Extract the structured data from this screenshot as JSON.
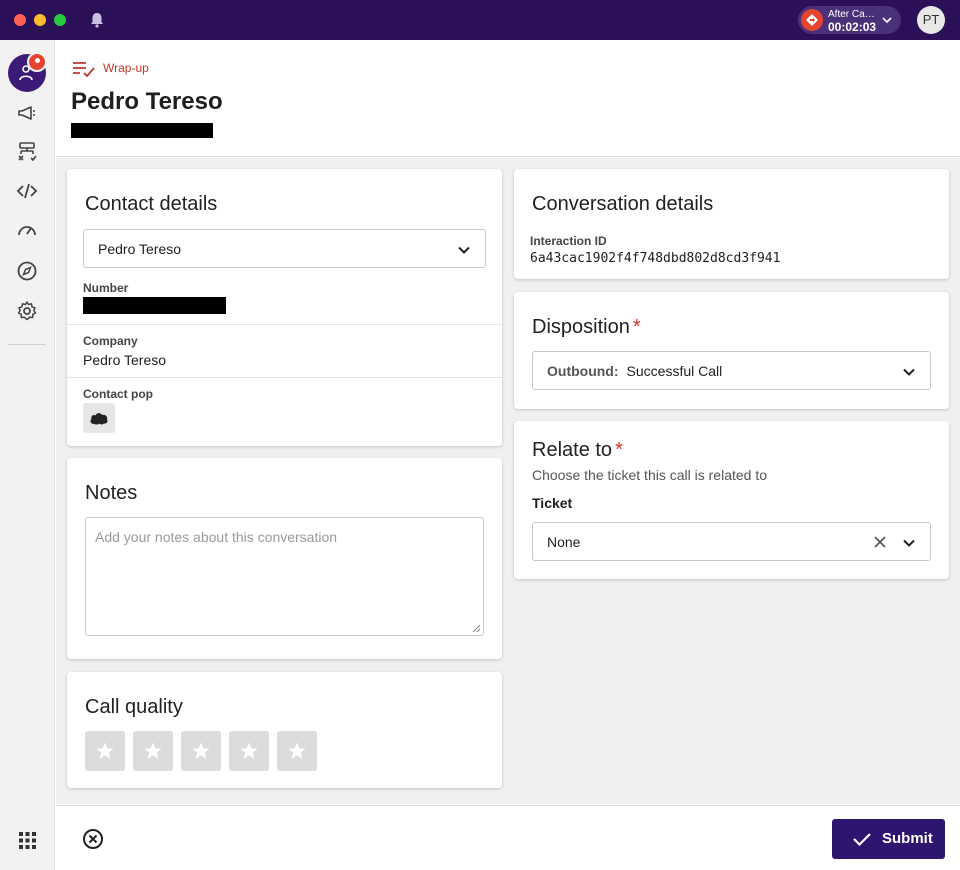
{
  "topbar": {
    "status_label": "After Call Work",
    "status_timer": "00:02:03",
    "avatar_initials": "PT"
  },
  "header": {
    "section_label": "Wrap-up",
    "contact_name": "Pedro Tereso"
  },
  "contact_details": {
    "title": "Contact details",
    "selected_contact": "Pedro Tereso",
    "number_label": "Number",
    "company_label": "Company",
    "company_value": "Pedro Tereso",
    "contact_pop_label": "Contact pop"
  },
  "notes": {
    "title": "Notes",
    "placeholder": "Add your notes about this conversation",
    "value": ""
  },
  "call_quality": {
    "title": "Call quality",
    "rating": 0,
    "max_rating": 5
  },
  "conversation_details": {
    "title": "Conversation details",
    "interaction_id_label": "Interaction ID",
    "interaction_id": "6a43cac1902f4f748dbd802d8cd3f941"
  },
  "disposition": {
    "title": "Disposition",
    "required_mark": "*",
    "prefix": "Outbound:",
    "value": "Successful Call"
  },
  "relate_to": {
    "title": "Relate to",
    "required_mark": "*",
    "subtitle": "Choose the ticket this call is related to",
    "ticket_label": "Ticket",
    "ticket_value": "None"
  },
  "footer": {
    "submit_label": "Submit"
  },
  "colors": {
    "titlebar": "#2b0f57",
    "brand_primary": "#2e1570",
    "accent_red": "#e5452f",
    "required": "#d93025"
  }
}
